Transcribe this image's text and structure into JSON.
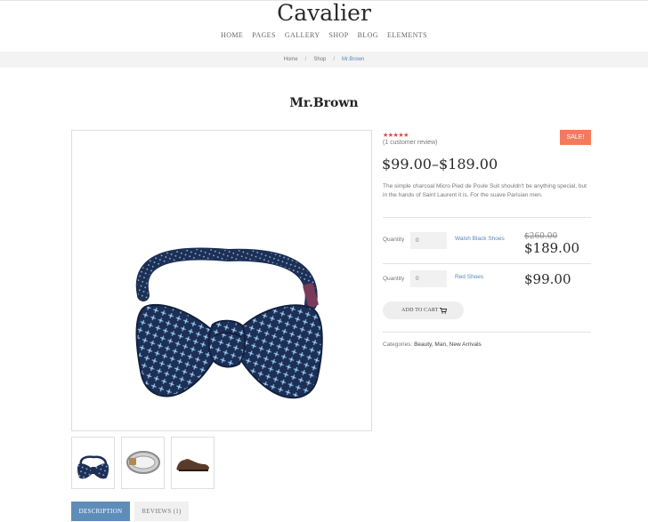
{
  "site": {
    "logo": "Cavalier"
  },
  "nav": {
    "items": [
      "HOME",
      "PAGES",
      "GALLERY",
      "SHOP",
      "BLOG",
      "ELEMENTS"
    ]
  },
  "breadcrumb": {
    "home": "Home",
    "shop": "Shop",
    "current": "Mr.Brown",
    "separator": "/"
  },
  "product": {
    "title": "Mr.Brown",
    "rating_stars": "★★★★★",
    "review_count": "(1 customer review)",
    "sale_badge": "SALE!",
    "price_range": "$99.00–$189.00",
    "description": "The simple charcoal Micro Pied de Poule Suit shouldn't be anything special, but in the hands of Saint Laurent it is. For the suave Parisian men.",
    "grouped": [
      {
        "qty_label": "Quantity",
        "qty_value": "0",
        "name": "Walsh Black Shoes",
        "old_price": "$260.00",
        "price": "$189.00"
      },
      {
        "qty_label": "Quantity",
        "qty_value": "0",
        "name": "Red Shoes",
        "old_price": "",
        "price": "$99.00"
      }
    ],
    "add_to_cart": "ADD TO CART",
    "categories_label": "Categories:",
    "categories": "Beauty, Man, New Arrivals"
  },
  "tabs": {
    "description": "DESCRIPTION",
    "reviews": "REVIEWS (1)"
  },
  "colors": {
    "accent": "#5e8dba",
    "sale": "#f47a5c",
    "star": "#e0453a",
    "link": "#5b86b8"
  },
  "icons": {
    "cart": "cart-icon",
    "star": "star-icon"
  }
}
